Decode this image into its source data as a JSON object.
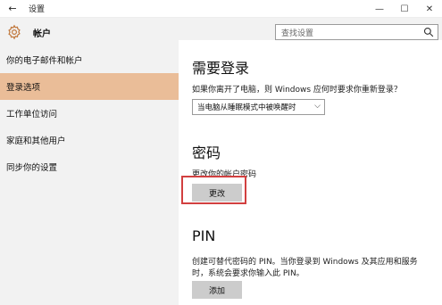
{
  "window": {
    "back_icon": "←",
    "title": "设置",
    "minimize": "—",
    "maximize": "☐",
    "close": "✕"
  },
  "sidebar": {
    "icon": "gear-icon",
    "title": "帐户",
    "items": [
      {
        "label": "你的电子邮件和帐户",
        "active": false
      },
      {
        "label": "登录选项",
        "active": true
      },
      {
        "label": "工作单位访问",
        "active": false
      },
      {
        "label": "家庭和其他用户",
        "active": false
      },
      {
        "label": "同步你的设置",
        "active": false
      }
    ]
  },
  "search": {
    "placeholder": "查找设置",
    "icon": "search-icon"
  },
  "main": {
    "require_signin": {
      "heading": "需要登录",
      "description": "如果你离开了电脑，则 Windows 应何时要求你重新登录？",
      "dropdown_value": "当电脑从睡眠模式中被唤醒时"
    },
    "password": {
      "heading": "密码",
      "description": "更改你的帐户密码",
      "button": "更改"
    },
    "pin": {
      "heading": "PIN",
      "description_line1": "创建可替代密码的 PIN。当你登录到 Windows 及其应用和服务",
      "description_line2": "时，系统会要求你输入此 PIN。",
      "button": "添加"
    }
  },
  "colors": {
    "active_nav": "#eabd98",
    "highlight_border": "#d24040",
    "accent_icon": "#c0763a"
  }
}
